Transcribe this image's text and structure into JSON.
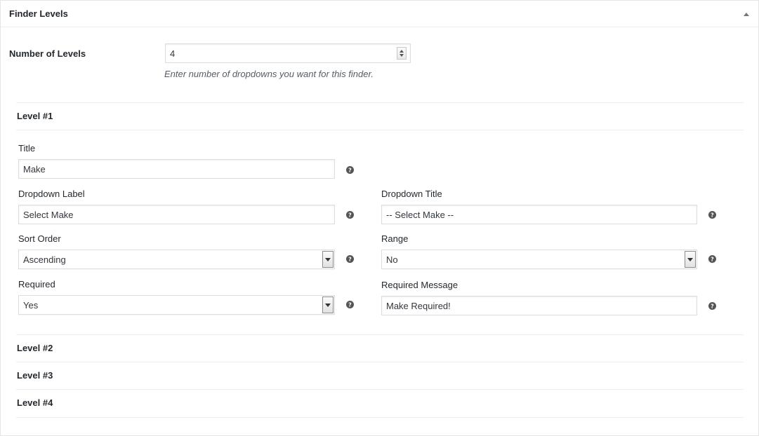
{
  "panel": {
    "title": "Finder Levels",
    "toggle_icon": "triangle-up-icon"
  },
  "levels_setting": {
    "label": "Number of Levels",
    "value": "4",
    "hint": "Enter number of dropdowns you want for this finder."
  },
  "levels": [
    {
      "label": "Level #1",
      "expanded": true
    },
    {
      "label": "Level #2",
      "expanded": false
    },
    {
      "label": "Level #3",
      "expanded": false
    },
    {
      "label": "Level #4",
      "expanded": false
    }
  ],
  "level1": {
    "title": {
      "label": "Title",
      "value": "Make"
    },
    "dropdown_label": {
      "label": "Dropdown Label",
      "value": "Select Make"
    },
    "dropdown_title": {
      "label": "Dropdown Title",
      "value": "-- Select Make --"
    },
    "sort_order": {
      "label": "Sort Order",
      "value": "Ascending"
    },
    "range": {
      "label": "Range",
      "value": "No"
    },
    "required": {
      "label": "Required",
      "value": "Yes"
    },
    "required_message": {
      "label": "Required Message",
      "value": "Make Required!"
    }
  },
  "icons": {
    "help": "help-question-icon",
    "dropdown": "chevron-down-icon",
    "spinner": "spinner-arrows-icon"
  }
}
